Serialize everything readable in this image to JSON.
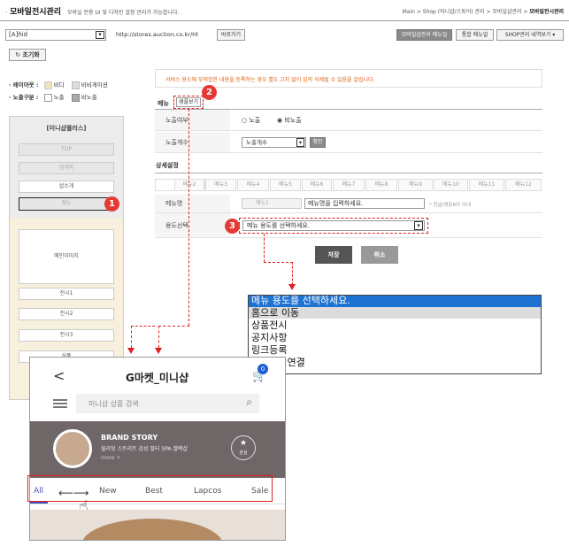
{
  "header": {
    "title": "모바일전시관리",
    "desc": "모바일 전용 UI 및 디자인 설정 관리가 가능합니다.",
    "breadcrumb": "Main > Shop (미니샵/스토어) 관리 > 모바일샵관리 > ",
    "breadcrumb_current": "모바일전시관리"
  },
  "toolbar": {
    "shop_select": "[A]hid",
    "url": "http://stores.auction.co.kr/Hl",
    "visit_btn": "바로가기",
    "manual_btn": "모바일샵관리 매뉴얼",
    "integrated_btn": "통합 매뉴얼",
    "history_btn": "SHOP관리 내역보기 ▾",
    "reset_btn": "초기화"
  },
  "legend": {
    "layout_label": "· 레이아웃 :",
    "layout_active": "비디",
    "layout_inactive": "비비게이션",
    "exposure_label": "· 노출구분 :",
    "exposure_on": "노출",
    "exposure_off": "비노출"
  },
  "nav": {
    "title": "[미니샵플러스]",
    "items": [
      "TOP",
      "검색바",
      "샵소개",
      "메뉴"
    ],
    "lower_items": [
      "메인이미지",
      "전시1",
      "전시2",
      "전시3",
      "상품"
    ]
  },
  "notice": "서비스 용도에 부적합한 내용을 등록하는 경우 별도 고지 없이 임의 삭제될 수 있음을 알립니다.",
  "menu_section": {
    "label": "메뉴",
    "sample_btn": "샘플보기",
    "exposure_label": "노출여부",
    "exposure_on": "노출",
    "exposure_off": "비노출",
    "count_label": "노출개수",
    "count_select": "노출개수",
    "confirm_btn": "확인"
  },
  "detail": {
    "title": "상세설정",
    "tabs": [
      "메뉴1",
      "메뉴2",
      "메뉴3",
      "메뉴4",
      "메뉴5",
      "메뉴6",
      "메뉴7",
      "메뉴8",
      "메뉴9",
      "메뉴10",
      "메뉴11",
      "메뉴12"
    ],
    "name_label": "메뉴명",
    "name_tab_value": "메뉴1",
    "name_placeholder": "메뉴명을 입력하세요.",
    "name_hint": "* 한글/영문8자 이내",
    "use_label": "용도선택",
    "use_select": "메뉴 용도를 선택하세요."
  },
  "actions": {
    "save": "저장",
    "cancel": "취소"
  },
  "dropdown": {
    "options": [
      "메뉴 용도를 선택하세요.",
      "홈으로 이동",
      "상품전시",
      "공지사항",
      "링크등록",
      "카테고리연결"
    ]
  },
  "callouts": [
    "1",
    "2",
    "3"
  ],
  "phone": {
    "back": "<",
    "title": "G마켓_미니샵",
    "cart_count": "0",
    "search_placeholder": "미니샵 상품 검색",
    "brand_title": "BRAND STORY",
    "brand_desc": "힐리엇 스트리트 감성 필터 SPA 셀렉샵",
    "brand_more": "more +",
    "fav_label": "관심",
    "tabs": [
      "All",
      "New",
      "Best",
      "Lapcos",
      "Sale"
    ]
  },
  "colors": {
    "accent_red": "#e53935",
    "dash_red": "#e02020",
    "gray_btn": "#8a8a8a",
    "cream": "#f6f0dc"
  }
}
